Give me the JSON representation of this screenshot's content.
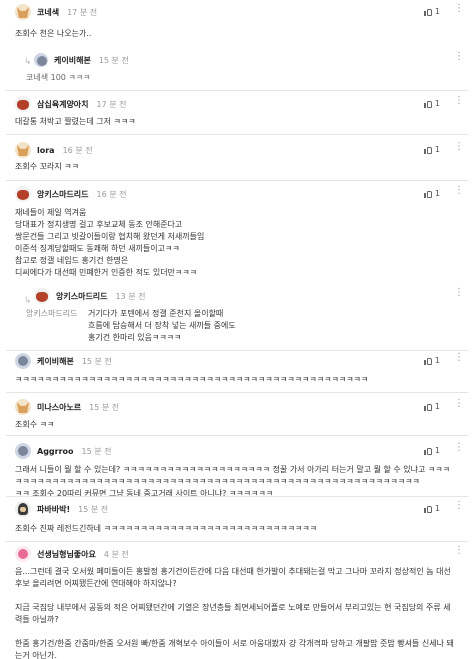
{
  "comments": [
    {
      "nick": "코네색",
      "time": "17 분 전",
      "body": "조회수 천은 나오는가..",
      "likes": "1"
    },
    {
      "nick": "케이비해본",
      "time": "15 분 전",
      "body": "코네색 100 ㅋㅋㅋ",
      "reply": true
    },
    {
      "nick": "삼십육계양아치",
      "time": "17 분 전",
      "body": "대갈통 처박고 짤렸는데 그저 ㅋㅋㅋ",
      "likes": "1"
    },
    {
      "nick": "lora",
      "time": "16 분 전",
      "body": "조회수 꼬라지 ㅋㅋ",
      "likes": "1"
    },
    {
      "nick": "앙키스마드리드",
      "time": "16 분 전",
      "body": "재네들이 제일 역겨움\n당대표가 정치생명 걸고 후보교체 동조 안해준다고\n쌍문건들 그리고 빗갈이들이랑 협치해 왔던게 저새끼들임\n이준석 징계당할때도 동쾌해 하던 새끼들이고ㅋㅋ\n참고로 정갤 네임드 홍기건 한명은\n디씨에다가 대선때 민폐한거 인증한 적도 있더만ㅋㅋㅋ",
      "likes": "1"
    },
    {
      "nick": "앙키스마드리드",
      "time": "13 분 전",
      "quote": "앙키스마드리드",
      "body": "거기다가 포텐에서 정갤 준천지 올이할때\n흐름에 탑승해서 더 장착 넣는 새끼들 중에도\n홍기건 한마리 있음ㅋㅋㅋㅋ",
      "reply": true
    },
    {
      "nick": "케이비해본",
      "time": "15 분 전",
      "body": "ㅋㅋㅋㅋㅋㅋㅋㅋㅋㅋㅋㅋㅋㅋㅋㅋㅋㅋㅋㅋㅋㅋㅋㅋㅋㅋㅋㅋㅋㅋㅋㅋㅋㅋㅋㅋㅋㅋㅋㅋㅋㅋㅋㅋㅋㅋㅋㅋ",
      "likes": "1"
    },
    {
      "nick": "미나스아노르",
      "time": "15 분 전",
      "body": "조회수 ㅋㅋ",
      "likes": "1"
    },
    {
      "nick": "Aggrroo",
      "time": "15 분 전",
      "body": "그래서 니들이 뭘 할 수 있는데? ㅋㅋㅋㅋㅋㅋㅋㅋㅋㅋㅋㅋㅋㅋㅋㅋㅋㅋㅋㅋ 정꿀 가서 아가리 터는거 말고 뭘 할 수 있냐고 ㅋㅋㅋㅋㅋㅋㅋㅋㅋㅋㅋㅋㅋㅋㅋㅋㅋㅋㅋㅋㅋㅋㅋㅋㅋㅋㅋㅋㅋㅋㅋㅋㅋㅋㅋㅋㅋㅋㅋㅋㅋㅋㅋㅋㅋㅋㅋㅋㅋㅋㅋㅋㅋㅋㅋㅋㅋㅋ\nㅋㅋ 조회수 20따리 커뮤면 그냥 동네 중고거래 사이트 아니냐? ㅋㅋㅋㅋㅋㅋ",
      "likes": "1"
    },
    {
      "nick": "파바바박!",
      "time": "15 분 전",
      "body": "조회수 진짜 레전드긴하네 ㅋㅋㅋㅋㅋㅋㅋㅋㅋㅋㅋㅋㅋㅋㅋㅋㅋㅋㅋㅋㅋㅋㅋㅋㅋㅋㅋㅋㅋ",
      "likes": "1"
    },
    {
      "nick": "선생님형님좋아요",
      "time": "4 분 전",
      "body": "음...그런데 결국 오서웠 페미들이든 홍발정 홍기건이든간에 다음 대선때 한가발이 추대돼는걸 막고 그나마 꼬라지 정상적인 놈 대선후보 올리려면 어찌됐든간에 연대해야 하지않나?\n\n지금 국짐당 내부에서 공동의 적은 어찌됐던간에 기열은 장년층들 최면세뇌어플로 노예로 만들어서 부리고있는 현 국짐당의 주류 세력들 아닐까?\n\n한줌 홍기건/한줌 간줌마/한줌 오서원 빠/한줌 개혁보수 아이들이 서로 아웅대봤자 걍 각개격파 당하고 개팔밥 줏밥 빵셔들 신세나 돼는거 아닌가."
    }
  ]
}
